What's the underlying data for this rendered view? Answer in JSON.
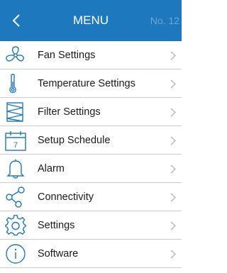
{
  "header": {
    "title": "MENU",
    "serial": "No. 12",
    "background": "#1e78be",
    "back_icon": "chevron-left-icon"
  },
  "menu": {
    "items": [
      {
        "label": "Fan Settings",
        "icon": "fan-icon"
      },
      {
        "label": "Temperature Settings",
        "icon": "thermometer-icon"
      },
      {
        "label": "Filter Settings",
        "icon": "filter-icon"
      },
      {
        "label": "Setup Schedule",
        "icon": "calendar-icon",
        "calendar_day": "7"
      },
      {
        "label": "Alarm",
        "icon": "bell-icon"
      },
      {
        "label": "Connectivity",
        "icon": "share-icon"
      },
      {
        "label": "Settings",
        "icon": "gear-icon"
      },
      {
        "label": "Software",
        "icon": "info-icon"
      }
    ],
    "chevron_icon": "chevron-right-icon"
  },
  "colors": {
    "icon": "#1e78be",
    "separator": "#c9c9c9",
    "chevron": "#b5b5b5"
  }
}
